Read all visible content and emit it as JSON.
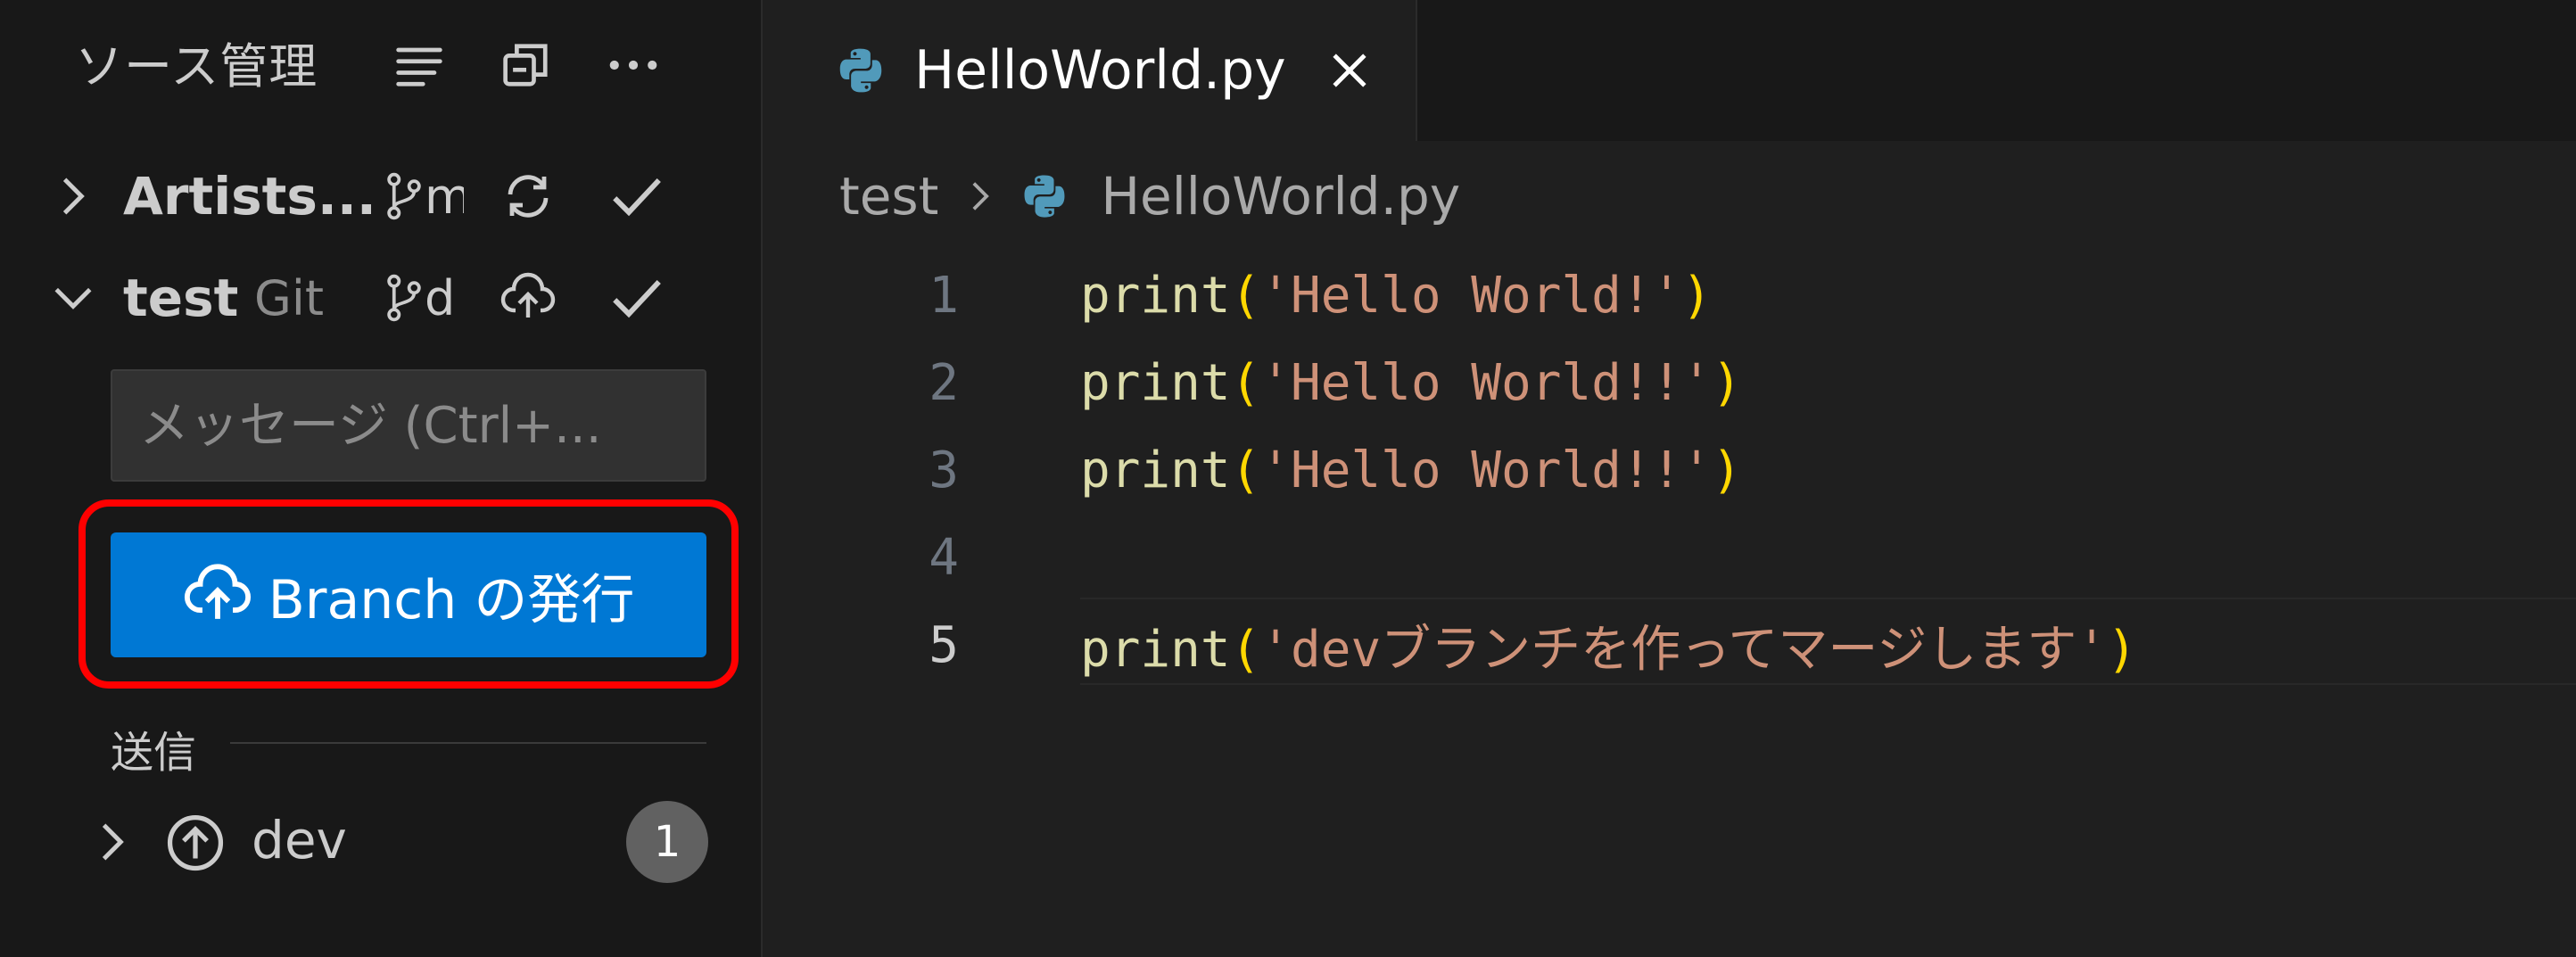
{
  "sidebar": {
    "title": "ソース管理",
    "repos": [
      {
        "name": "Artists...",
        "provider": "",
        "branch": "m",
        "expanded": false
      },
      {
        "name": "test",
        "provider": "Git",
        "branch": "d",
        "expanded": true
      }
    ],
    "commit_placeholder": "メッセージ (Ctrl+...",
    "publish_label": "Branch の発行",
    "section_label": "送信",
    "outgoing": {
      "label": "dev",
      "count": "1"
    }
  },
  "editor": {
    "tab_label": "HelloWorld.py",
    "breadcrumb": {
      "folder": "test",
      "file": "HelloWorld.py"
    },
    "lines": [
      {
        "number": "1",
        "fn": "print",
        "open": "(",
        "str": "'Hello World!'",
        "close": ")"
      },
      {
        "number": "2",
        "fn": "print",
        "open": "(",
        "str": "'Hello World!!'",
        "close": ")"
      },
      {
        "number": "3",
        "fn": "print",
        "open": "(",
        "str": "'Hello World!!'",
        "close": ")"
      },
      {
        "number": "4",
        "fn": "",
        "open": "",
        "str": "",
        "close": ""
      },
      {
        "number": "5",
        "fn": "print",
        "open": "(",
        "str": "'devブランチを作ってマージします'",
        "close": ")"
      }
    ],
    "active_line": "5"
  },
  "colors": {
    "publish_button": "#0078d4",
    "highlight_border": "#ff0000",
    "function": "#dcdcaa",
    "paren": "#ffd700",
    "string": "#ce9178"
  }
}
